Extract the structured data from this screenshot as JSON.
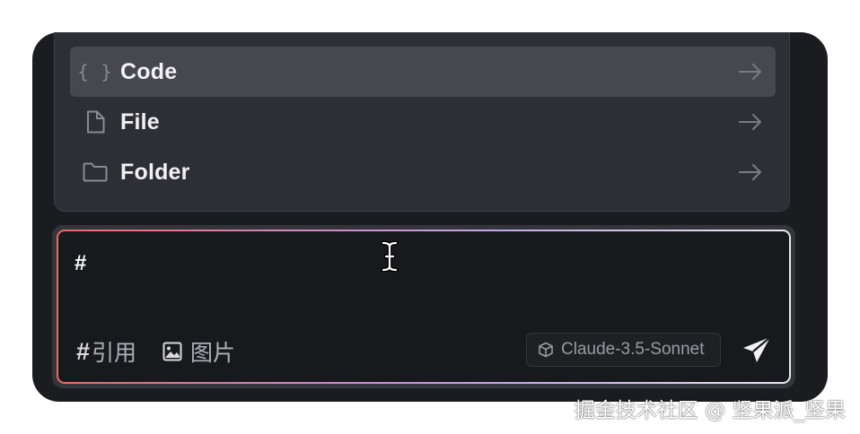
{
  "menu": {
    "items": [
      {
        "icon": "code-braces-icon",
        "label": "Code",
        "active": true
      },
      {
        "icon": "file-icon",
        "label": "File",
        "active": false
      },
      {
        "icon": "folder-icon",
        "label": "Folder",
        "active": false
      }
    ]
  },
  "input": {
    "value": "#"
  },
  "toolbar": {
    "reference_symbol": "#",
    "reference_label": "引用",
    "image_label": "图片",
    "model_label": "Claude-3.5-Sonnet"
  },
  "code_glyph": "{ }",
  "watermark": "掘金技术社区 @ 坚果派_坚果",
  "colors": {
    "window_bg": "#1b1c20",
    "menu_bg": "#2e2f35",
    "active_item_bg": "#46474f",
    "input_border_gradient": [
      "#ee6a62",
      "#d38ad6",
      "#c5a7ee",
      "#e8e8ee"
    ]
  }
}
